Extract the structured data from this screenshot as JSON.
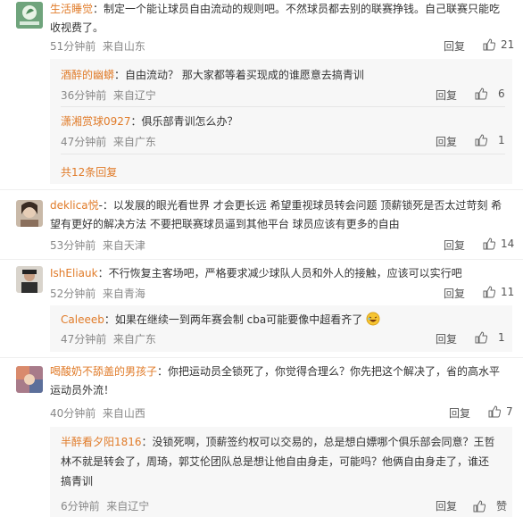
{
  "comments": [
    {
      "user": "生活睡觉",
      "content": "：制定一个能让球员自由流动的规则吧。不然球员都去别的联赛挣钱。自己联赛只能吃吃收视费了。",
      "line1": "：制定一个能让球员自由流动的规则吧。不然球员都去别的联赛挣钱。自己联赛只能吃",
      "line2": "收视费了。",
      "time": "51分钟前",
      "source": "来自山东",
      "reply_label": "回复",
      "likes": "21",
      "replies": [
        {
          "user": "酒醉的幽蟒",
          "content": "：自由流动？ 那大家都等着买现成的谁愿意去搞青训",
          "time": "36分钟前",
          "source": "来自辽宁",
          "reply_label": "回复",
          "likes": "6"
        },
        {
          "user": "潇湘赏球0927",
          "content": "：俱乐部青训怎么办？",
          "time": "47分钟前",
          "source": "来自广东",
          "reply_label": "回复",
          "likes": "1"
        }
      ],
      "more_replies": "共12条回复"
    },
    {
      "user": "deklica悦",
      "line1": "-：以发展的眼光看世界 才会更长远 希望重视球员转会问题 顶薪锁死是否太过苛刻 希",
      "line2": "望有更好的解决方法 不要把联赛球员逼到其他平台 球员应该有更多的自由",
      "time": "53分钟前",
      "source": "来自天津",
      "reply_label": "回复",
      "likes": "14"
    },
    {
      "user": "IshEliauk",
      "line1": "：不行恢复主客场吧，严格要求减少球队人员和外人的接触，应该可以实行吧",
      "time": "52分钟前",
      "source": "来自青海",
      "reply_label": "回复",
      "likes": "11",
      "replies": [
        {
          "user": "Caleeeb",
          "content": "：如果在继续一到两年赛会制 cba可能要像中超看齐了",
          "time": "47分钟前",
          "source": "来自广东",
          "reply_label": "回复",
          "likes": "1"
        }
      ]
    },
    {
      "user": "喝酸奶不舔盖的男孩子",
      "line1": "：你把运动员全锁死了，你觉得合理么？你先把这个解决了，省的高水平",
      "line2": "运动员外流！",
      "time": "40分钟前",
      "source": "来自山西",
      "reply_label": "回复",
      "likes": "7",
      "replies": [
        {
          "user": "半醉看夕阳1816",
          "line1": "：没锁死啊，顶薪签约权可以交易的，总是想白嫖哪个俱乐部会同意？王哲",
          "line2": "林不就是转会了，周琦，郭艾伦团队总是想让他自由身走，可能吗？他俩自由身走了，谁还",
          "line3": "搞青训",
          "time": "6分钟前",
          "source": "来自辽宁",
          "reply_label": "回复",
          "likes": "赞"
        }
      ]
    }
  ]
}
